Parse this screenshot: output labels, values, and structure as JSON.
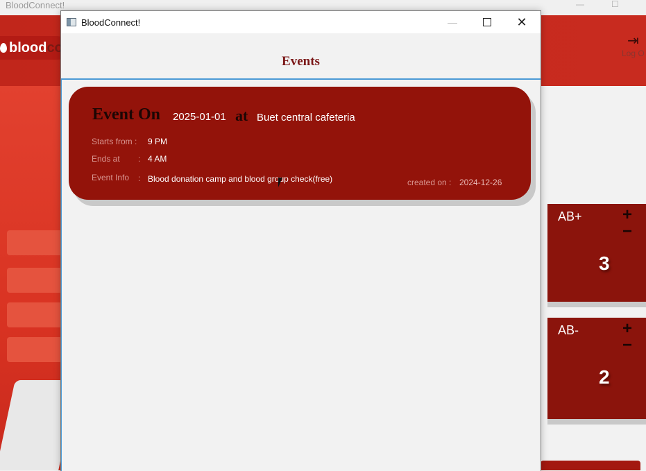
{
  "background_window": {
    "title": "BloodConnect!",
    "logo_text": "blood",
    "logo_text_cut": "co",
    "logout_label": "Log O",
    "blood_cards": [
      {
        "type": "AB+",
        "count": "3"
      },
      {
        "type": "AB-",
        "count": "2"
      }
    ]
  },
  "dialog": {
    "title": "BloodConnect!",
    "header": "Events",
    "event": {
      "event_on_label": "Event On",
      "date": "2025-01-01",
      "at_label": "at",
      "place": "Buet central cafeteria",
      "starts_label": "Starts from :",
      "starts_value": "9 PM",
      "ends_label": "Ends at",
      "ends_colon": ":",
      "ends_value": "4 AM",
      "info_label": "Event Info",
      "info_colon": ":",
      "info_value": "Blood donation camp and blood group check(free)",
      "created_label": "created on :",
      "created_value": "2024-12-26"
    }
  },
  "colors": {
    "card_red": "#93130a",
    "header_red": "#c1261b",
    "title_red": "#7b1818",
    "accent_blue": "#4b9ad6"
  }
}
